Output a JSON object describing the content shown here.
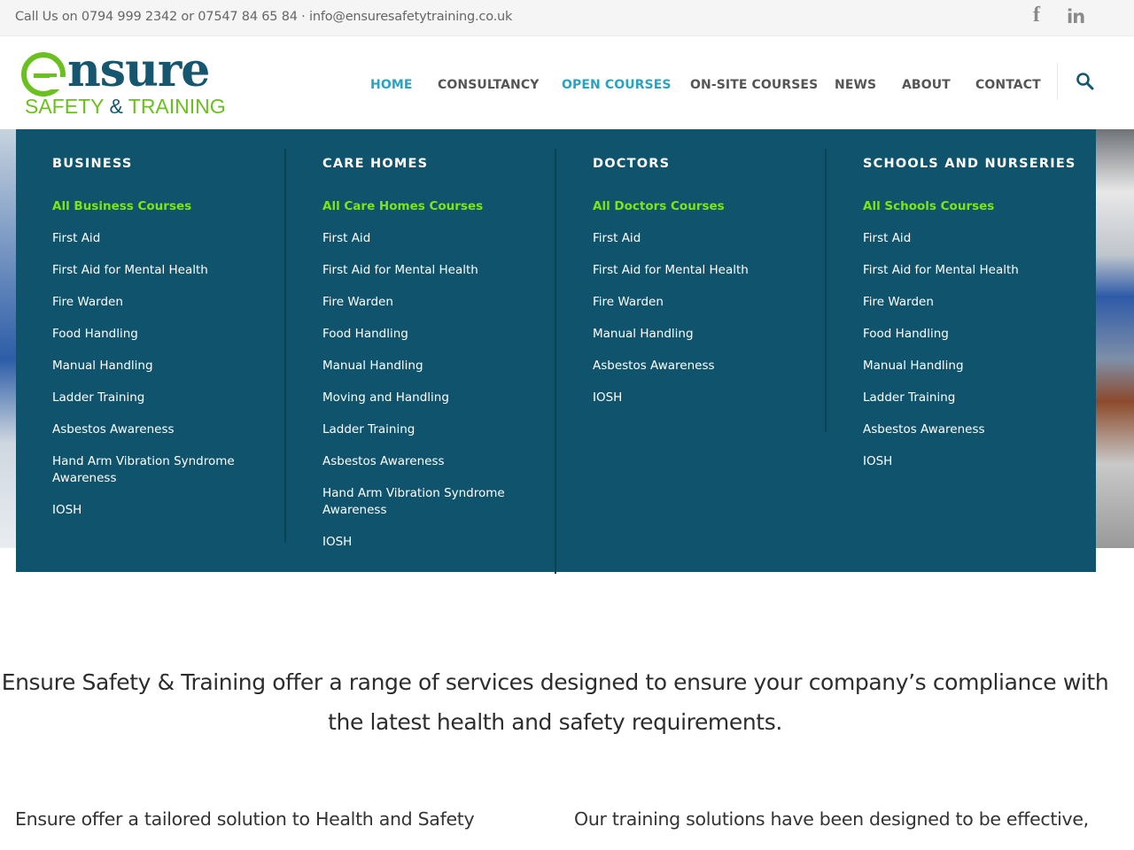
{
  "topbar": {
    "contact": "Call Us on 0794 999 2342 or 07547 84 65 84 · info@ensuresafetytraining.co.uk",
    "facebook_glyph": "f",
    "linkedin_glyph": "in"
  },
  "logo": {
    "word": "nsure",
    "tag_left": "SAFETY",
    "tag_amp": "&",
    "tag_right": "TRAINING"
  },
  "nav": {
    "items": [
      {
        "label": "HOME",
        "active": true
      },
      {
        "label": "CONSULTANCY",
        "active": false
      },
      {
        "label": "OPEN COURSES",
        "active": true
      },
      {
        "label": "ON-SITE COURSES",
        "active": false
      },
      {
        "label": "NEWS",
        "active": false
      },
      {
        "label": "ABOUT",
        "active": false
      },
      {
        "label": "CONTACT",
        "active": false
      }
    ]
  },
  "mega_menu": {
    "columns": [
      {
        "title": "BUSINESS",
        "links": [
          "All Business Courses",
          "First Aid",
          "First Aid for Mental Health",
          "Fire Warden",
          "Food Handling",
          "Manual Handling",
          "Ladder Training",
          "Asbestos Awareness",
          "Hand Arm Vibration Syndrome Awareness",
          "IOSH"
        ]
      },
      {
        "title": "CARE HOMES",
        "links": [
          "All Care Homes Courses",
          "First Aid",
          "First Aid for Mental Health",
          "Fire Warden",
          "Food Handling",
          "Manual Handling",
          "Moving and Handling",
          "Ladder Training",
          "Asbestos Awareness",
          "Hand Arm Vibration Syndrome Awareness",
          "IOSH"
        ]
      },
      {
        "title": "DOCTORS",
        "links": [
          "All Doctors Courses",
          "First Aid",
          "First Aid for Mental Health",
          "Fire Warden",
          "Manual Handling",
          "Asbestos Awareness",
          "IOSH"
        ]
      },
      {
        "title": "SCHOOLS AND NURSERIES",
        "links": [
          "All Schools Courses",
          "First Aid",
          "First Aid for Mental Health",
          "Fire Warden",
          "Food Handling",
          "Manual Handling",
          "Ladder Training",
          "Asbestos Awareness",
          "IOSH"
        ]
      }
    ]
  },
  "content": {
    "intro": "Ensure Safety & Training offer a range of services designed to ensure your company’s compliance with the latest health and safety requirements.",
    "para_left": "Ensure offer a tailored solution to Health and Safety",
    "para_right": "Our training solutions have been designed to be effective,"
  },
  "colors": {
    "menu_bg": "#0f546c",
    "accent_green": "#7ce70f",
    "nav_active": "#29a3c0",
    "brand_blue": "#16566f",
    "brand_green": "#6ac01f"
  },
  "icons": {
    "search": "search-icon",
    "facebook": "facebook-icon",
    "linkedin": "linkedin-icon"
  }
}
